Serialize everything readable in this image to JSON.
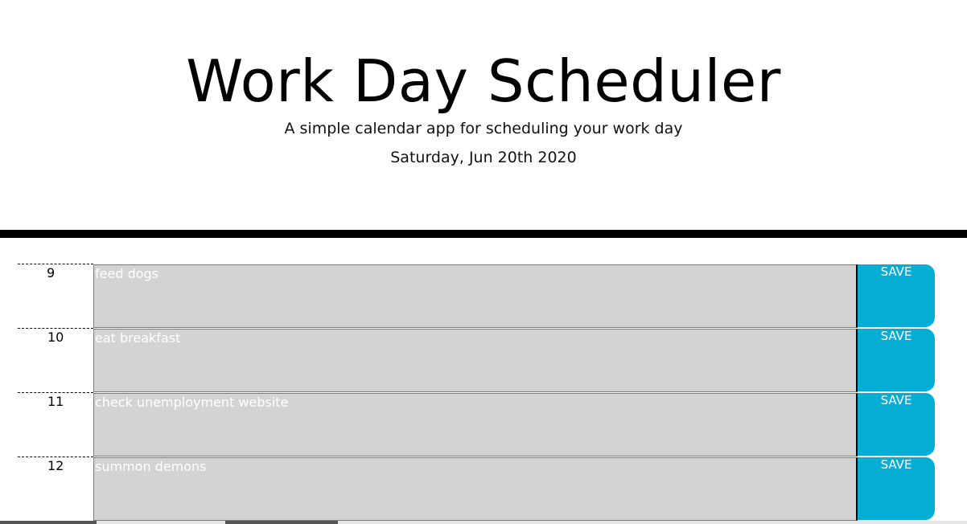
{
  "header": {
    "title": "Work Day Scheduler",
    "subtitle": "A simple calendar app for scheduling your work day",
    "date": "Saturday, Jun 20th 2020"
  },
  "colors": {
    "save_button": "#06aed5",
    "textarea_bg": "#d3d3d3",
    "divider": "#000000"
  },
  "schedule": [
    {
      "hour": "9",
      "text": "feed dogs",
      "save_label": "SAVE"
    },
    {
      "hour": "10",
      "text": "eat breakfast",
      "save_label": "SAVE"
    },
    {
      "hour": "11",
      "text": "check unemployment website",
      "save_label": "SAVE"
    },
    {
      "hour": "12",
      "text": "summon demons",
      "save_label": "SAVE"
    }
  ]
}
